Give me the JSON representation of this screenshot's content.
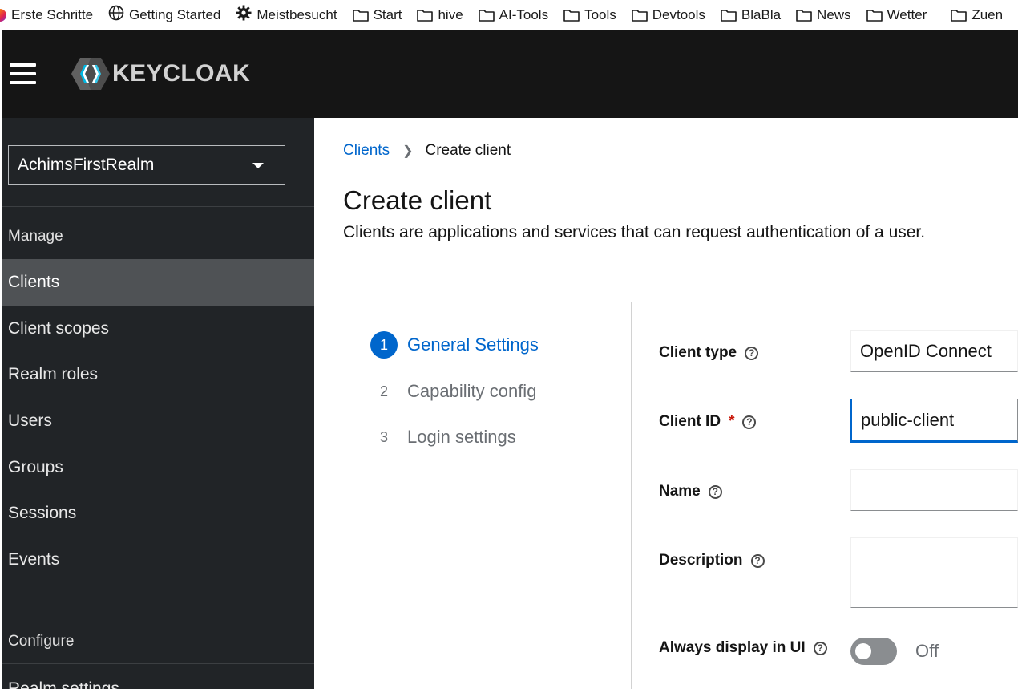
{
  "bookmarks": [
    {
      "label": "Erste Schritte",
      "icon": "firefox-icon"
    },
    {
      "label": "Getting Started",
      "icon": "globe-icon"
    },
    {
      "label": "Meistbesucht",
      "icon": "gear-icon"
    },
    {
      "label": "Start",
      "icon": "folder-icon"
    },
    {
      "label": "hive",
      "icon": "folder-icon"
    },
    {
      "label": "AI-Tools",
      "icon": "folder-icon"
    },
    {
      "label": "Tools",
      "icon": "folder-icon"
    },
    {
      "label": "Devtools",
      "icon": "folder-icon"
    },
    {
      "label": "BlaBla",
      "icon": "folder-icon"
    },
    {
      "label": "News",
      "icon": "folder-icon"
    },
    {
      "label": "Wetter",
      "icon": "folder-icon"
    },
    {
      "label": "Zuen",
      "icon": "folder-icon"
    }
  ],
  "header": {
    "brand": "KEYCLOAK"
  },
  "sidebar": {
    "realm": "AchimsFirstRealm",
    "manage_label": "Manage",
    "items": [
      {
        "label": "Clients",
        "active": true
      },
      {
        "label": "Client scopes"
      },
      {
        "label": "Realm roles"
      },
      {
        "label": "Users"
      },
      {
        "label": "Groups"
      },
      {
        "label": "Sessions"
      },
      {
        "label": "Events"
      }
    ],
    "configure_label": "Configure",
    "configure_items": [
      {
        "label": "Realm settings"
      }
    ]
  },
  "main": {
    "breadcrumb": {
      "parent": "Clients",
      "current": "Create client"
    },
    "title": "Create client",
    "description": "Clients are applications and services that can request authentication of a user.",
    "steps": [
      {
        "num": "1",
        "label": "General Settings",
        "current": true
      },
      {
        "num": "2",
        "label": "Capability config"
      },
      {
        "num": "3",
        "label": "Login settings"
      }
    ],
    "form": {
      "client_type_label": "Client type",
      "client_type_value": "OpenID Connect",
      "client_id_label": "Client ID",
      "required_mark": "*",
      "client_id_value": "public-client",
      "name_label": "Name",
      "name_value": "",
      "description_label": "Description",
      "description_value": "",
      "always_display_label": "Always display in UI",
      "always_display_state": "Off",
      "help_glyph": "?"
    }
  },
  "colors": {
    "accent": "#0066cc",
    "sidebar_bg": "#212427",
    "header_bg": "#151515",
    "active_item_bg": "#4f5255",
    "required": "#c9190b"
  }
}
